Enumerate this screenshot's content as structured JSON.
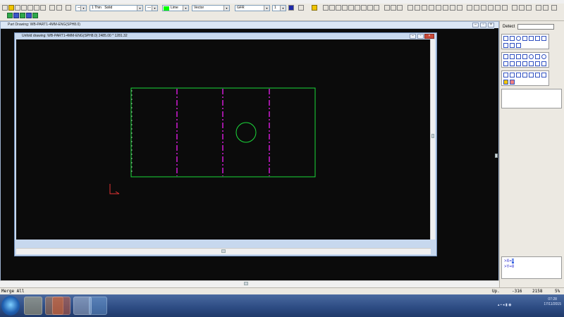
{
  "toolbar": {
    "line_width": "1 Thin",
    "line_style": "Solid",
    "color": "Lime",
    "color_hex": "#00ff00",
    "render_mode": "Vector",
    "layer": "GFR",
    "layer_num": "1"
  },
  "main_window": {
    "title": "Part Drawing: WB-PART1-4MM-ENG(SPH8.0)"
  },
  "drawing_window": {
    "title": "Unfold drawing: WB-PART1-4MM-ENG(SPH8.0) 2485.00 * 1281.32"
  },
  "right_panel": {
    "detect_label": "Detect",
    "coord_x_prefix": ">X=",
    "coord_x_value": "0",
    "coord_y": ">Y=0"
  },
  "status": {
    "mode": "Merge All",
    "orientation": "Up.",
    "x": "-316",
    "y": "2158",
    "zoom": "5%"
  },
  "taskbar": {
    "time": "07:28",
    "date": "17/11/2015"
  },
  "colors": {
    "outline": "#1bd83a",
    "bend_lines": "#d21ad6",
    "origin_marker": "#e33333",
    "canvas": "#0b0b0b"
  }
}
